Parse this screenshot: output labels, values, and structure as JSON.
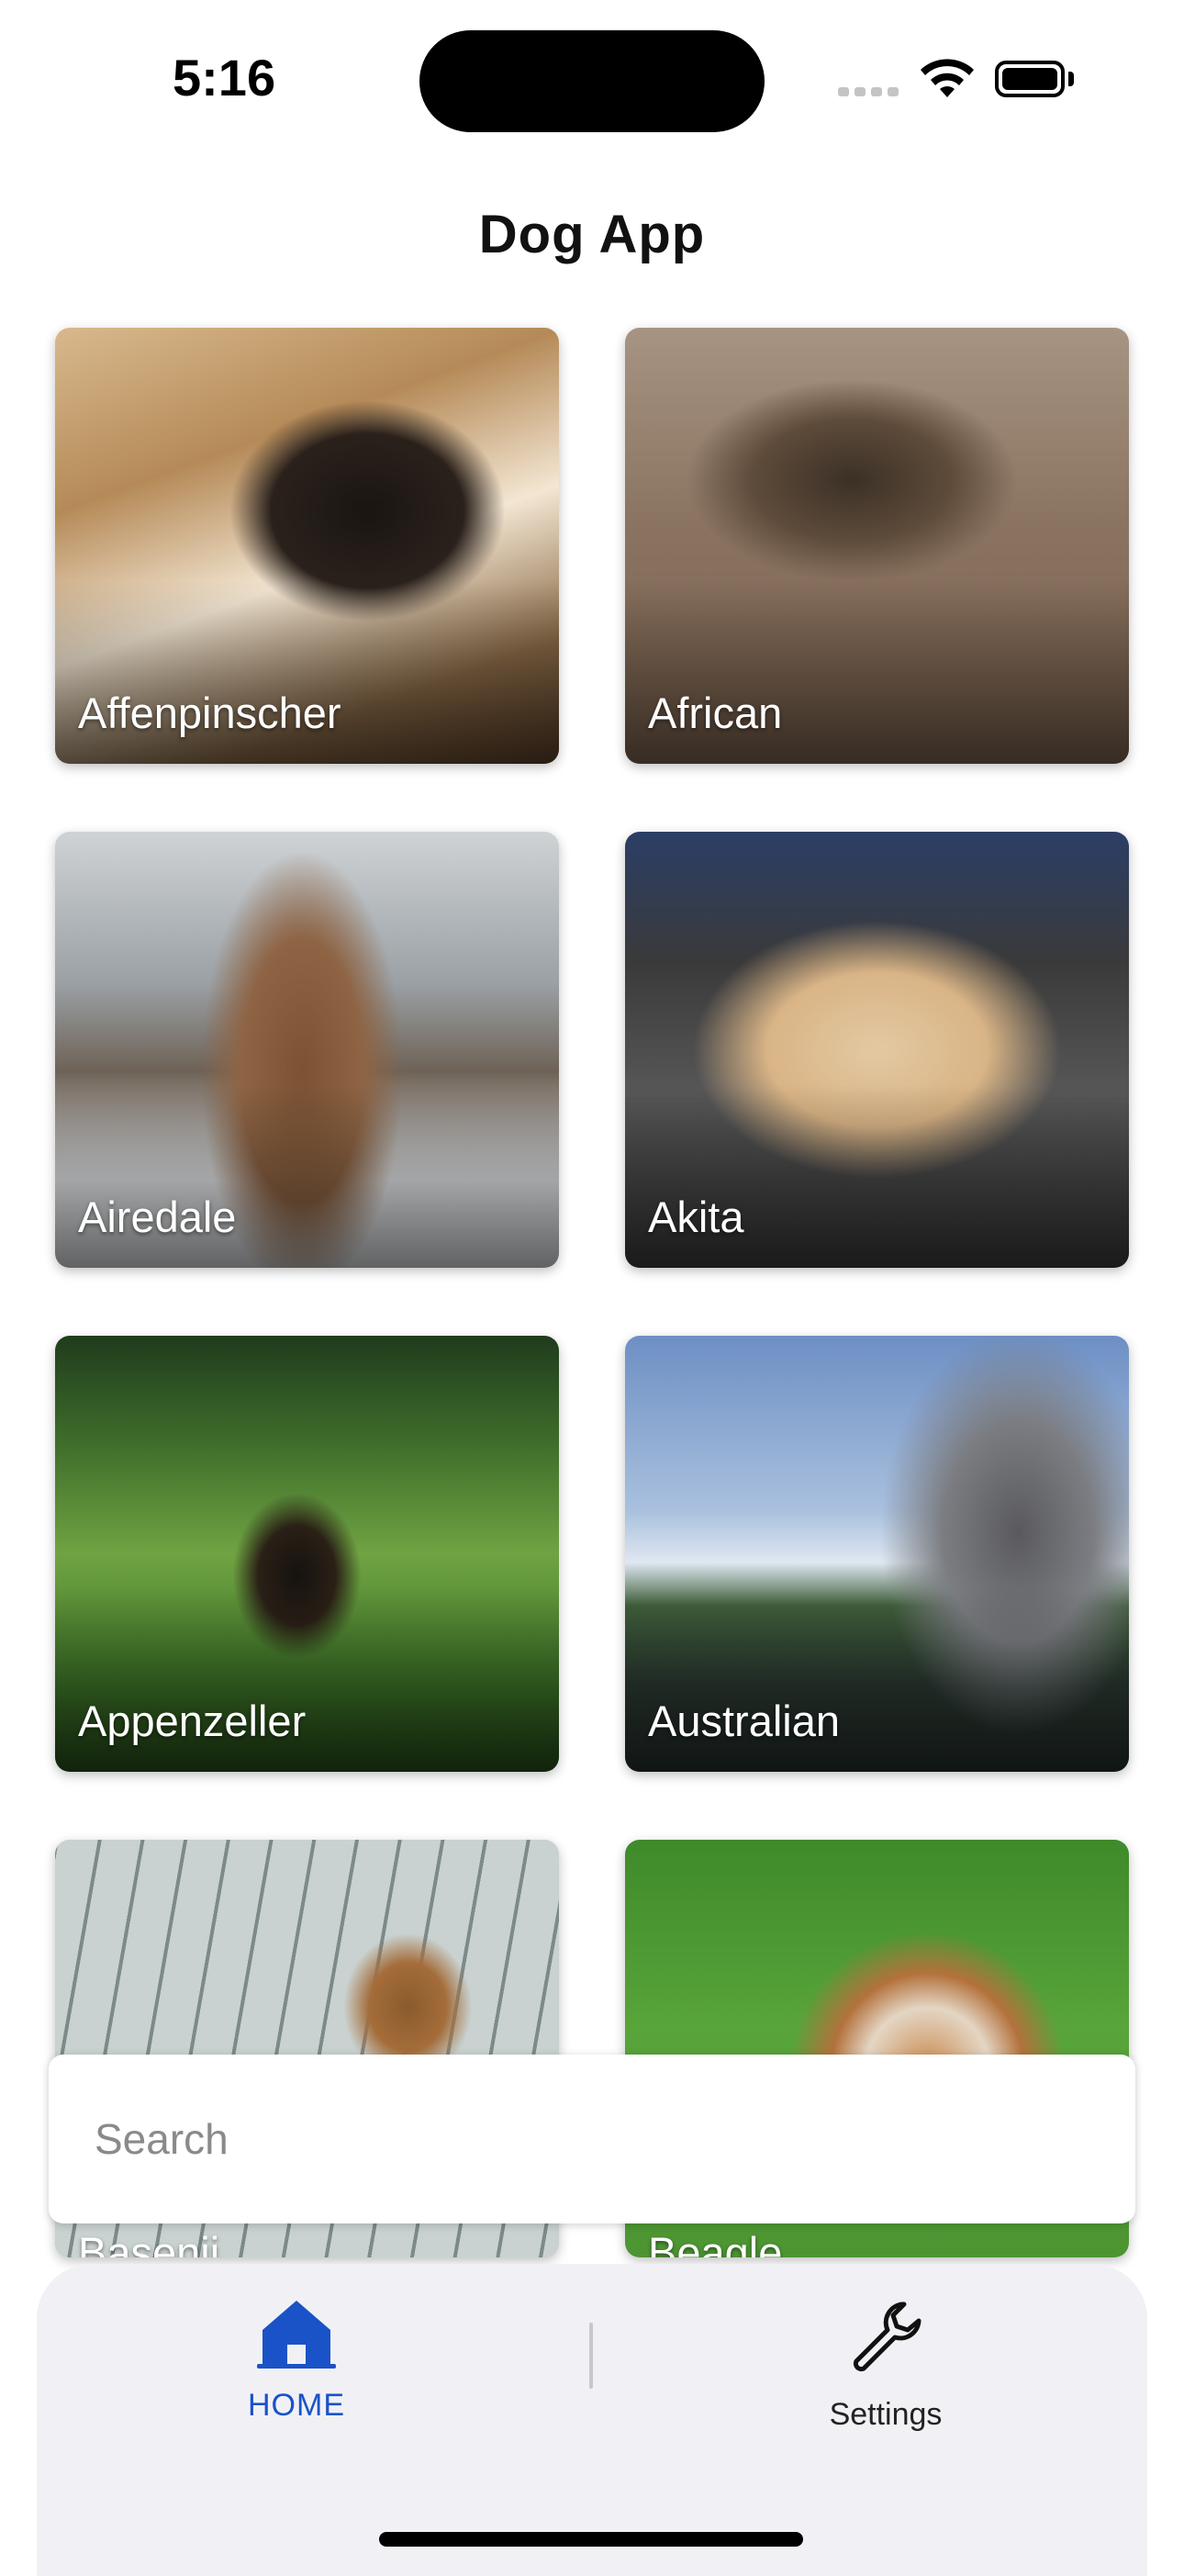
{
  "status_bar": {
    "time": "5:16"
  },
  "header": {
    "title": "Dog App"
  },
  "breeds": [
    {
      "name": "Affenpinscher"
    },
    {
      "name": "African"
    },
    {
      "name": "Airedale"
    },
    {
      "name": "Akita"
    },
    {
      "name": "Appenzeller"
    },
    {
      "name": "Australian"
    },
    {
      "name": "Basenji"
    },
    {
      "name": "Beagle"
    }
  ],
  "search": {
    "placeholder": "Search",
    "value": ""
  },
  "tab_bar": {
    "tabs": [
      {
        "label": "HOME",
        "icon": "home-icon",
        "active": true
      },
      {
        "label": "Settings",
        "icon": "wrench-icon",
        "active": false
      }
    ],
    "active_color": "#1a53c7"
  }
}
